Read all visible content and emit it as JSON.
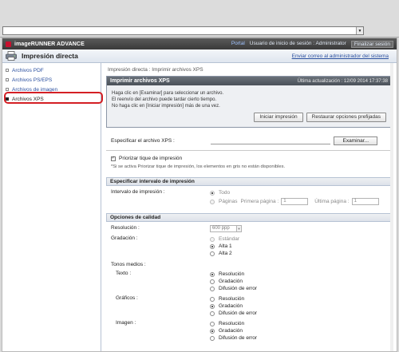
{
  "browser": {
    "address_value": ""
  },
  "topbar": {
    "brand": "imageRUNNER ADVANCE",
    "portal": "Portal",
    "user_label": "Usuario de inicio de sesión : Administrator",
    "logout": "Finalizar sesión"
  },
  "header": {
    "title": "Impresión directa",
    "send_mail": "Enviar correo al administrador del sistema"
  },
  "sidebar": {
    "items": [
      {
        "label": "Archivos PDF"
      },
      {
        "label": "Archivos PS/EPS"
      },
      {
        "label": "Archivos de imagen"
      },
      {
        "label": "Archivos XPS"
      }
    ]
  },
  "main": {
    "breadcrumb": "Impresión directa : Imprimir archivos XPS",
    "panel": {
      "title": "Imprimir archivos XPS",
      "updated": "Última actualización : 12/09 2014 17:37:38",
      "line1": "Haga clic en [Examinar] para seleccionar un archivo.",
      "line2": "El reenvío del archivo puede tardar cierto tiempo.",
      "line3": "No haga clic en [Iniciar impresión] más de una vez.",
      "start_btn": "Iniciar impresión",
      "restore_btn": "Restaurar opciones prefijadas"
    },
    "file": {
      "label": "Especificar el archivo XPS :",
      "browse": "Examinar..."
    },
    "priority": {
      "label": "Priorizar tique de impresión",
      "note": "*Si se activa Priorizar tique de impresión, los elementos en gris no están disponibles."
    },
    "range": {
      "section": "Especificar intervalo de impresión",
      "label": "Intervalo de impresión :",
      "all": "Todo",
      "pages": "Páginas",
      "first": "Primera página :",
      "first_val": "1",
      "last": "Última página :",
      "last_val": "1"
    },
    "quality": {
      "section": "Opciones de calidad",
      "resolution_label": "Resolución :",
      "resolution_val": "600 ppp",
      "gradation_label": "Gradación :",
      "grad_opts": [
        "Estándar",
        "Alta 1",
        "Alta 2"
      ],
      "halftone_label": "Tonos medios :",
      "text_label": "Texto :",
      "graphics_label": "Gráficos :",
      "image_label": "Imagen :",
      "tone_opts": [
        "Resolución",
        "Gradación",
        "Difusión de error"
      ]
    }
  }
}
